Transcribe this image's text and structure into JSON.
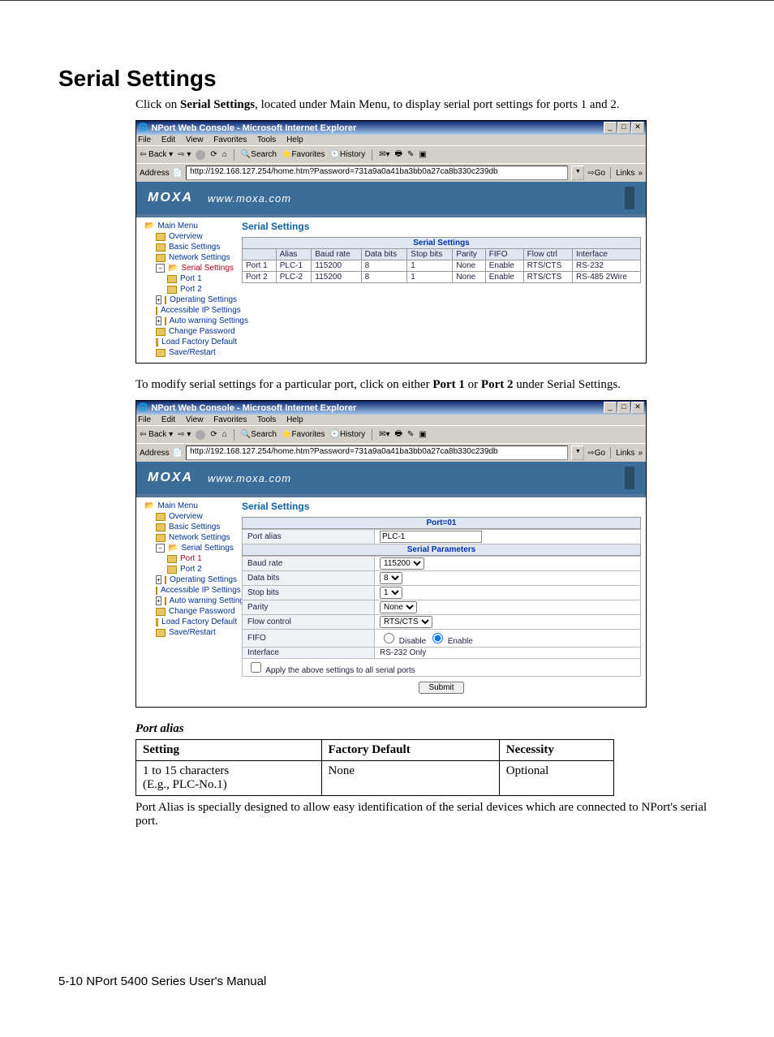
{
  "heading": "Serial Settings",
  "intro_pre": "Click on ",
  "intro_bold": "Serial Settings",
  "intro_post": ", located under Main Menu, to display serial port settings for ports 1 and 2.",
  "mid_pre": "To modify serial settings for a particular port, click on either ",
  "mid_b1": "Port 1",
  "mid_or": " or ",
  "mid_b2": "Port 2",
  "mid_post": " under Serial Settings.",
  "window_title": "NPort Web Console - Microsoft Internet Explorer",
  "menus": [
    "File",
    "Edit",
    "View",
    "Favorites",
    "Tools",
    "Help"
  ],
  "toolbar_labels": {
    "back": "Back",
    "search": "Search",
    "favorites": "Favorites",
    "history": "History"
  },
  "addr_label": "Address",
  "addr_url": "http://192.168.127.254/home.htm?Password=731a9a0a41ba3bb0a27ca8b330c239db",
  "go": "Go",
  "links": "Links",
  "logo": "MOXA",
  "banner_url": "www.moxa.com",
  "sidebar": {
    "main": "Main Menu",
    "overview": "Overview",
    "basic": "Basic Settings",
    "network": "Network Settings",
    "serial": "Serial Settings",
    "port1": "Port 1",
    "port2": "Port 2",
    "operating": "Operating Settings",
    "accessible": "Accessible IP Settings",
    "autowarn": "Auto warning Settings",
    "changepw": "Change Password",
    "loaddef": "Load Factory Default",
    "saverestart": "Save/Restart"
  },
  "panel_title": "Serial Settings",
  "table_caption": "Serial Settings",
  "table_headers": [
    "",
    "Alias",
    "Baud rate",
    "Data bits",
    "Stop bits",
    "Parity",
    "FIFO",
    "Flow ctrl",
    "Interface"
  ],
  "table_rows": [
    [
      "Port 1",
      "PLC-1",
      "115200",
      "8",
      "1",
      "None",
      "Enable",
      "RTS/CTS",
      "RS-232"
    ],
    [
      "Port 2",
      "PLC-2",
      "115200",
      "8",
      "1",
      "None",
      "Enable",
      "RTS/CTS",
      "RS-485 2Wire"
    ]
  ],
  "port_section": "Port=01",
  "param_section": "Serial Parameters",
  "form": {
    "alias_label": "Port alias",
    "alias_value": "PLC-1",
    "baud_label": "Baud rate",
    "baud_value": "115200",
    "databits_label": "Data bits",
    "databits_value": "8",
    "stopbits_label": "Stop bits",
    "stopbits_value": "1",
    "parity_label": "Parity",
    "parity_value": "None",
    "flow_label": "Flow control",
    "flow_value": "RTS/CTS",
    "fifo_label": "FIFO",
    "fifo_disable": "Disable",
    "fifo_enable": "Enable",
    "iface_label": "Interface",
    "iface_value": "RS-232 Only",
    "apply_label": "Apply the above settings to all serial ports",
    "submit": "Submit"
  },
  "portalias_head": "Port alias",
  "spec_headers": [
    "Setting",
    "Factory Default",
    "Necessity"
  ],
  "spec_row": [
    "1 to 15 characters\n(E.g., PLC-No.1)",
    "None",
    "Optional"
  ],
  "explain": "Port Alias is specially designed to allow easy identification of the serial devices which are connected to NPort's serial port.",
  "footer": "5-10  NPort 5400 Series User's Manual"
}
